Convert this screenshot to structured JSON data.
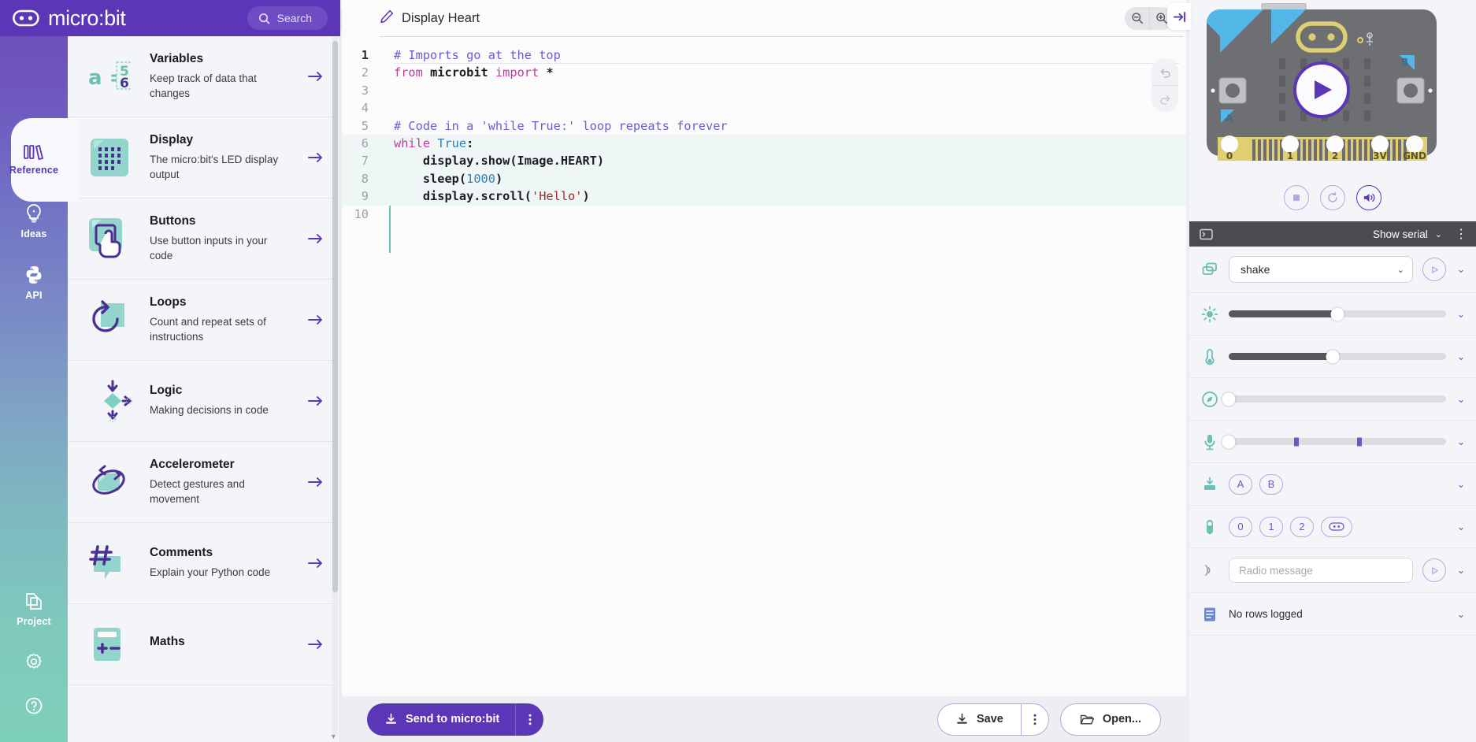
{
  "brand": {
    "name": "micro:bit",
    "logo_icon": "microbit-logo-icon"
  },
  "search": {
    "placeholder": "Search",
    "icon": "search-icon"
  },
  "rail": {
    "items": [
      {
        "label": "Reference",
        "icon": "books-icon",
        "active": true
      },
      {
        "label": "Ideas",
        "icon": "lightbulb-icon",
        "active": false
      },
      {
        "label": "API",
        "icon": "python-icon",
        "active": false
      }
    ],
    "bottom": [
      {
        "label": "Project",
        "icon": "copy-files-icon"
      },
      {
        "label": "",
        "icon": "gear-icon"
      },
      {
        "label": "",
        "icon": "help-circle-icon"
      }
    ]
  },
  "reference": {
    "collapse_icon": "collapse-left-icon",
    "items": [
      {
        "title": "Variables",
        "desc": "Keep track of data that changes",
        "icon": "variables-icon"
      },
      {
        "title": "Display",
        "desc": "The micro:bit's LED display output",
        "icon": "led-display-icon"
      },
      {
        "title": "Buttons",
        "desc": "Use button inputs in your code",
        "icon": "button-press-icon"
      },
      {
        "title": "Loops",
        "desc": "Count and repeat sets of instructions",
        "icon": "loop-arrow-icon"
      },
      {
        "title": "Logic",
        "desc": "Making decisions in code",
        "icon": "decision-diamond-icon"
      },
      {
        "title": "Accelerometer",
        "desc": "Detect gestures and movement",
        "icon": "accelerometer-icon"
      },
      {
        "title": "Comments",
        "desc": "Explain your Python code",
        "icon": "hash-comment-icon"
      },
      {
        "title": "Maths",
        "desc": "",
        "icon": "calculator-icon"
      }
    ],
    "arrow_icon": "arrow-right-icon"
  },
  "editor": {
    "project_name": "Display Heart",
    "edit_icon": "pencil-icon",
    "zoom_out_icon": "zoom-out-icon",
    "zoom_in_icon": "zoom-in-icon",
    "undo_icon": "undo-icon",
    "redo_icon": "redo-icon",
    "lines": [
      {
        "n": "1",
        "tokens": [
          {
            "t": "# Imports go at the top",
            "c": "tok-c"
          }
        ]
      },
      {
        "n": "2",
        "tokens": [
          {
            "t": "from ",
            "c": "tok-k"
          },
          {
            "t": "microbit",
            "c": "tok-b"
          },
          {
            "t": " import ",
            "c": "tok-k"
          },
          {
            "t": "*",
            "c": "tok-b"
          }
        ]
      },
      {
        "n": "3",
        "tokens": []
      },
      {
        "n": "4",
        "tokens": []
      },
      {
        "n": "5",
        "tokens": [
          {
            "t": "# Code in a 'while True:' loop repeats forever",
            "c": "tok-c"
          }
        ]
      },
      {
        "n": "6",
        "tokens": [
          {
            "t": "while ",
            "c": "tok-k"
          },
          {
            "t": "True",
            "c": "tok-n"
          },
          {
            "t": ":",
            "c": "tok-b"
          }
        ],
        "hl": true
      },
      {
        "n": "7",
        "tokens": [
          {
            "t": "    display.show(Image.HEART)",
            "c": "tok-b"
          }
        ],
        "hl": true
      },
      {
        "n": "8",
        "tokens": [
          {
            "t": "    sleep(",
            "c": "tok-b"
          },
          {
            "t": "1000",
            "c": "tok-n"
          },
          {
            "t": ")",
            "c": "tok-b"
          }
        ],
        "hl": true
      },
      {
        "n": "9",
        "tokens": [
          {
            "t": "    display.scroll(",
            "c": "tok-b"
          },
          {
            "t": "'Hello'",
            "c": "tok-s"
          },
          {
            "t": ")",
            "c": "tok-b"
          }
        ],
        "hl": true
      },
      {
        "n": "10",
        "tokens": []
      }
    ]
  },
  "toolbar": {
    "send_label": "Send to micro:bit",
    "send_icon": "download-to-device-icon",
    "send_more_icon": "kebab-menu-icon",
    "save_label": "Save",
    "save_icon": "download-icon",
    "save_more_icon": "kebab-menu-icon",
    "open_label": "Open...",
    "open_icon": "folder-open-icon"
  },
  "simulator": {
    "expand_icon": "expand-right-icon",
    "board": {
      "pins": [
        "0",
        "1",
        "2",
        "3V",
        "GND"
      ],
      "button_a_label": "A",
      "button_b_label": "B",
      "play_icon": "play-icon"
    },
    "controls": [
      {
        "name": "stop-button",
        "icon": "stop-icon",
        "active": false
      },
      {
        "name": "reset-button",
        "icon": "reset-icon",
        "active": false
      },
      {
        "name": "mute-button",
        "icon": "speaker-icon",
        "active": true
      }
    ],
    "serial": {
      "icon": "terminal-icon",
      "label": "Show serial",
      "caret_icon": "chevron-down-icon",
      "kebab_icon": "kebab-menu-icon"
    },
    "sensors": {
      "gesture": {
        "icon": "gesture-icon",
        "value": "shake",
        "play_icon": "play-icon",
        "chevron": "chevron-down-icon"
      },
      "light": {
        "icon": "sun-icon",
        "percent": 50,
        "chevron": "chevron-down-icon"
      },
      "temperature": {
        "icon": "thermometer-icon",
        "percent": 48,
        "chevron": "chevron-down-icon"
      },
      "compass": {
        "icon": "compass-icon",
        "percent": 0,
        "chevron": "chevron-down-icon"
      },
      "microphone": {
        "icon": "microphone-icon",
        "percent": 0,
        "ticks": [
          31,
          60
        ],
        "chevron": "chevron-down-icon"
      },
      "buttons": {
        "icon": "button-input-icon",
        "pills": [
          "A",
          "B"
        ],
        "chevron": "chevron-down-icon"
      },
      "pins": {
        "icon": "pin-touch-icon",
        "pills": [
          "0",
          "1",
          "2"
        ],
        "logo_pill_icon": "microbit-logo-icon",
        "chevron": "chevron-down-icon"
      },
      "radio": {
        "icon": "radio-waves-icon",
        "placeholder": "Radio message",
        "send_icon": "play-icon",
        "chevron": "chevron-down-icon"
      },
      "data_log": {
        "icon": "log-file-icon",
        "label": "No rows logged",
        "chevron": "chevron-down-icon"
      }
    }
  },
  "colors": {
    "brand_purple": "#5B37B7",
    "teal": "#6BBFB5",
    "board_grey": "#6E6F73",
    "pin_gold": "#E0CE73"
  }
}
